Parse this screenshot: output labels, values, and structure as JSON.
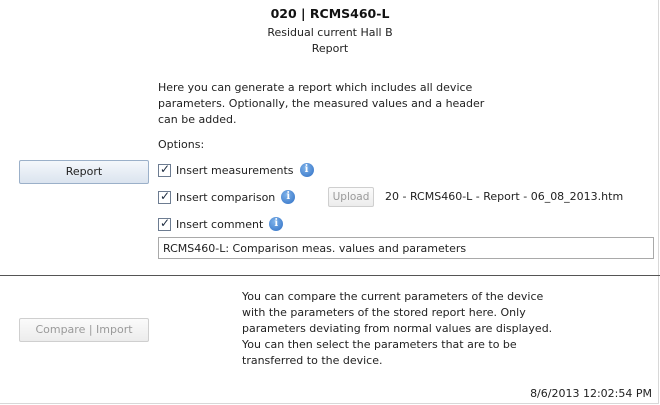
{
  "header": {
    "title": "020 | RCMS460-L",
    "subtitle": "Residual current Hall B",
    "section": "Report"
  },
  "report": {
    "description": "Here you can generate a report which includes all device parameters. Optionally, the measured values and a header can be added.",
    "options_label": "Options:",
    "button_label": "Report",
    "options": {
      "measurements": {
        "label": "Insert measurements",
        "checked": true
      },
      "comparison": {
        "label": "Insert comparison",
        "checked": true
      },
      "comment": {
        "label": "Insert comment",
        "checked": true
      }
    },
    "upload_label": "Upload",
    "filename": "20 - RCMS460-L - Report - 06_08_2013.htm",
    "comment_value": "RCMS460-L: Comparison meas. values and parameters"
  },
  "compare": {
    "button_label": "Compare | Import",
    "description": "You can compare the current parameters of the device with the parameters of the stored report here. Only parameters deviating from normal values are displayed. You can then select the parameters that are to be transferred to the device."
  },
  "footer": {
    "timestamp": "8/6/2013 12:02:54 PM"
  },
  "icons": {
    "info": "info-icon",
    "checkbox": "checkmark-icon"
  },
  "colors": {
    "info_blue": "#2f6fc4",
    "button_border": "#9bb0c9",
    "disabled_text": "#9a9a9a"
  }
}
